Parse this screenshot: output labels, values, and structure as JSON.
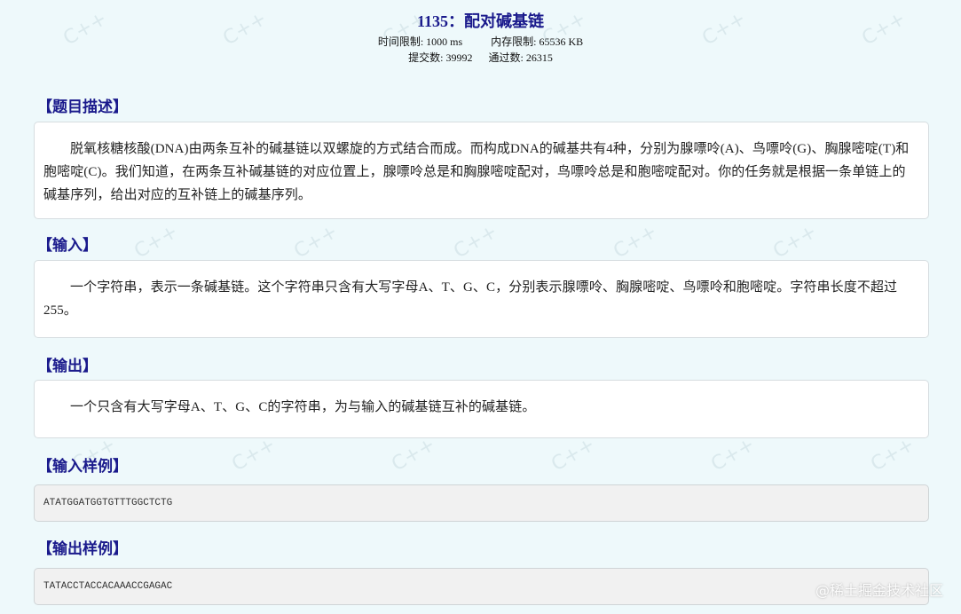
{
  "problem": {
    "title": "1135：配对碱基链",
    "time_limit_label": "时间限制:",
    "time_limit": "1000 ms",
    "memory_limit_label": "内存限制:",
    "memory_limit": "65536 KB",
    "submissions_label": "提交数:",
    "submissions": "39992",
    "accepted_label": "通过数:",
    "accepted": "26315"
  },
  "sections": {
    "description": {
      "title": "【题目描述】",
      "text": "脱氧核糖核酸(DNA)由两条互补的碱基链以双螺旋的方式结合而成。而构成DNA的碱基共有4种，分别为腺嘌呤(A)、鸟嘌呤(G)、胸腺嘧啶(T)和胞嘧啶(C)。我们知道，在两条互补碱基链的对应位置上，腺嘌呤总是和胸腺嘧啶配对，鸟嘌呤总是和胞嘧啶配对。你的任务就是根据一条单链上的碱基序列，给出对应的互补链上的碱基序列。"
    },
    "input": {
      "title": "【输入】",
      "text": "一个字符串，表示一条碱基链。这个字符串只含有大写字母A、T、G、C，分别表示腺嘌呤、胸腺嘧啶、鸟嘌呤和胞嘧啶。字符串长度不超过255。"
    },
    "output": {
      "title": "【输出】",
      "text": "一个只含有大写字母A、T、G、C的字符串，为与输入的碱基链互补的碱基链。"
    },
    "sample_input": {
      "title": "【输入样例】",
      "code": "ATATGGATGGTGTTTGGCTCTG"
    },
    "sample_output": {
      "title": "【输出样例】",
      "code": "TATACCTACCACAAACCGAGAC"
    }
  },
  "watermark": {
    "text": "@稀土掘金技术社区",
    "background_mark": "C++"
  },
  "colors": {
    "background": "#eef9fb",
    "heading": "#1a1a8c",
    "box": "#ffffff",
    "code_box": "#f1f1f1"
  }
}
